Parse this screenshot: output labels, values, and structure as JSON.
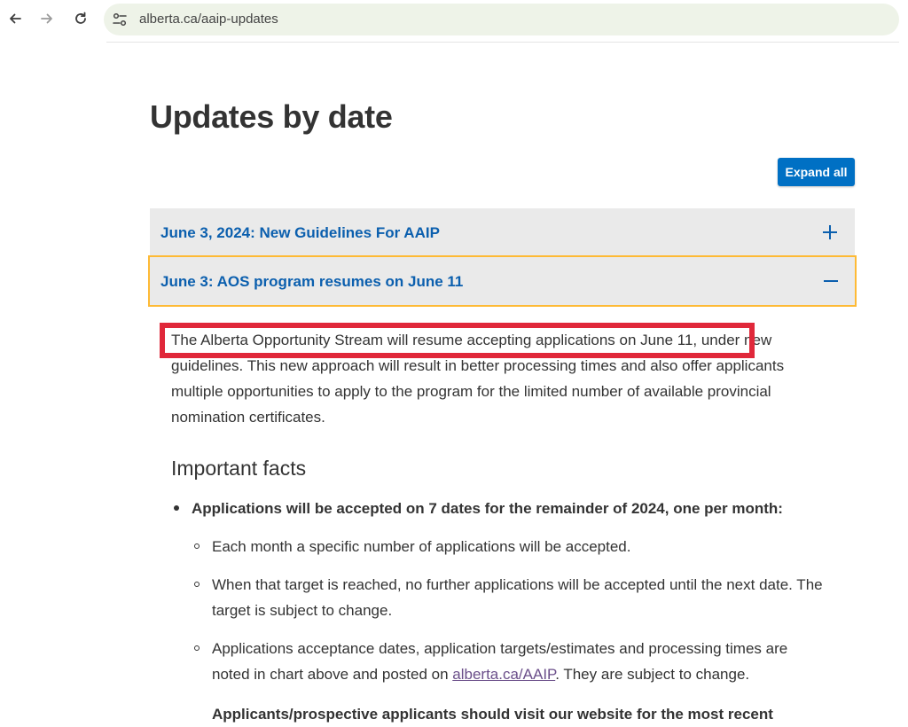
{
  "browser": {
    "url": "alberta.ca/aaip-updates",
    "icons": {
      "back": "arrow-left-icon",
      "forward": "arrow-right-icon",
      "reload": "reload-icon",
      "site_info": "tune-icon"
    }
  },
  "page": {
    "title": "Updates by date",
    "expand_all_label": "Expand all",
    "accordion": [
      {
        "label": "June 3, 2024: New Guidelines For AAIP",
        "state": "collapsed",
        "icon": "plus-icon"
      },
      {
        "label": "June 3: AOS program resumes on June 11",
        "state": "expanded",
        "icon": "minus-icon"
      }
    ],
    "content": {
      "paragraph": "The Alberta Opportunity Stream will resume accepting applications on June 11, under new guidelines. This new approach will result in better processing times and also offer applicants multiple opportunities to apply to the program for the limited number of available provincial nomination certificates.",
      "subheading": "Important facts",
      "main_bullet": "Applications will be accepted on 7 dates for the remainder of 2024, one per month:",
      "sub_bullets": [
        {
          "text": "Each month a specific number of applications will be accepted."
        },
        {
          "text": "When that target is reached, no further applications will be accepted until the next date. The target is subject to change."
        },
        {
          "text_before": "Applications acceptance dates, application targets/estimates and processing times are noted in chart above and posted on ",
          "link": "alberta.ca/AAIP",
          "text_after": ". They are subject to change."
        }
      ],
      "cutoff_text": "Applicants/prospective applicants should visit our website for the most recent"
    }
  },
  "colors": {
    "accent_blue": "#0070c4",
    "accordion_text": "#0b5fae",
    "focus_outline": "#feba35",
    "annotation_red": "#e0283a",
    "link_visited": "#6b4f8a"
  }
}
